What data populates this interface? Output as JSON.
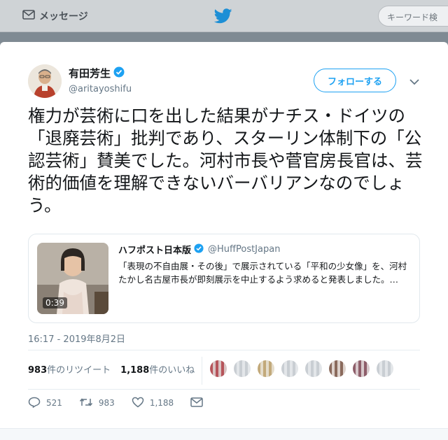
{
  "nav": {
    "messages_label": "メッセージ",
    "search_placeholder": "キーワード検"
  },
  "tweet": {
    "author_name": "有田芳生",
    "author_handle": "@aritayoshifu",
    "verified": true,
    "follow_label": "フォローする",
    "text": "権力が芸術に口を出した結果がナチス・ドイツの「退廃芸術」批判であり、スターリン体制下の「公認芸術」賛美でした。河村市長や菅官房長官は、芸術的価値を理解できないバーバリアンなのでしょう。",
    "timestamp": "16:17 - 2019年8月2日"
  },
  "quote": {
    "name": "ハフポスト日本版",
    "handle": "@HuffPostJapan",
    "verified": true,
    "text": "「表現の不自由展・その後」で展示されている「平和の少女像」を、河村たかし名古屋市長が即刻展示を中止するよう求めると発表しました。…",
    "video_duration": "0:39"
  },
  "stats": {
    "retweets_count": "983",
    "retweets_label": "件のリツイート",
    "likes_count": "1,188",
    "likes_label": "件のいいね"
  },
  "actions": {
    "replies": "521",
    "retweets": "983",
    "likes": "1,188"
  },
  "colors": {
    "accent": "#1da1f2",
    "text": "#14171a",
    "muted": "#657786"
  }
}
